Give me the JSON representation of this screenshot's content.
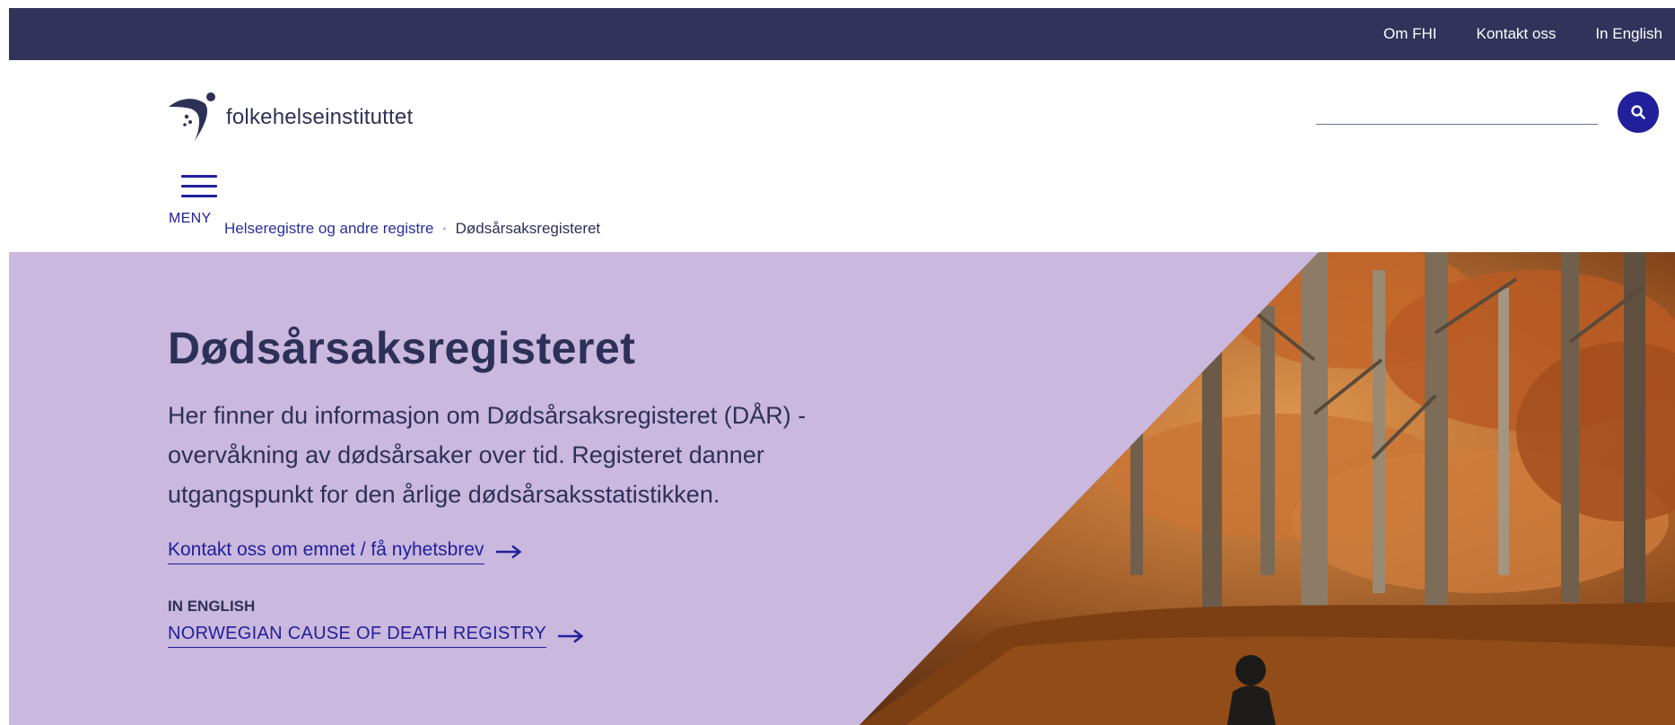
{
  "topbar": {
    "links": [
      "Om FHI",
      "Kontakt oss",
      "In English"
    ]
  },
  "header": {
    "logo_text": "folkehelseinstituttet",
    "search": {
      "value": "",
      "placeholder": ""
    },
    "menu_label": "MENY"
  },
  "breadcrumb": {
    "items": [
      "Helseregistre og andre registre",
      "Dødsårsaksregisteret"
    ]
  },
  "hero": {
    "title": "Dødsårsaksregisteret",
    "lead": "Her finner du informasjon om Dødsårsaksregisteret (DÅR) - overvåkning av dødsårsaker over tid. Registeret danner utgangspunkt for den årlige dødsårsaksstatistikken.",
    "contact_link": "Kontakt oss om emnet / få nyhetsbrev",
    "english_eyebrow": "IN ENGLISH",
    "english_link": "NORWEGIAN CAUSE OF DEATH REGISTRY",
    "background_color": "#cab8de"
  },
  "icons": {
    "search": "search-icon",
    "menu": "hamburger-menu-icon",
    "arrow": "arrow-right-icon",
    "logo": "fhi-logo"
  },
  "colors": {
    "topbar": "#32335a",
    "accent": "#20209a",
    "text": "#2d3157",
    "hero": "#cab8de"
  }
}
